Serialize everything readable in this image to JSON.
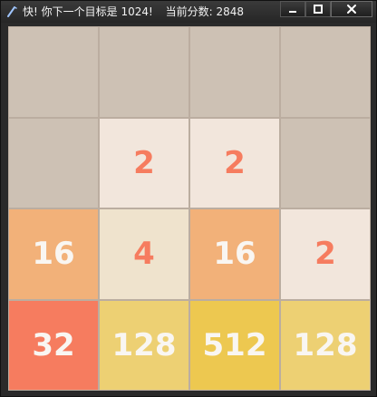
{
  "window": {
    "title": "快! 你下一个目标是 1024!",
    "score_label": "当前分数: 2848",
    "controls": {
      "minimize": "minimize-icon",
      "maximize": "maximize-icon",
      "close": "close-icon"
    }
  },
  "board": {
    "rows": 4,
    "cols": 4,
    "tiles": [
      [
        "",
        "",
        "",
        ""
      ],
      [
        "",
        "2",
        "2",
        ""
      ],
      [
        "16",
        "4",
        "16",
        "2"
      ],
      [
        "32",
        "128",
        "512",
        "128"
      ]
    ]
  },
  "colors": {
    "empty": "#cdc1b4",
    "2": "#f2e6dc",
    "4": "#efe3cd",
    "16": "#f2b179",
    "32": "#f67c5f",
    "128": "#edd073",
    "512": "#edc850",
    "dark_text": "#f67c5f",
    "light_text": "#f9f6f2"
  }
}
